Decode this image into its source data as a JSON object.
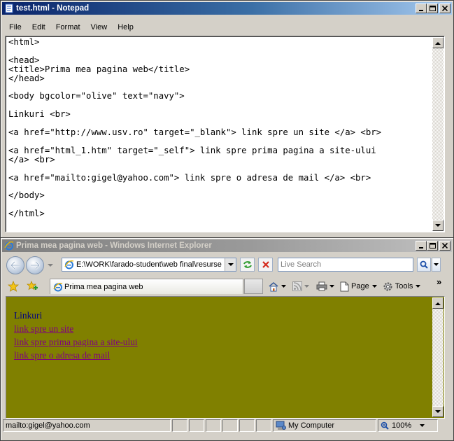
{
  "notepad": {
    "title": "test.html - Notepad",
    "menu": [
      "File",
      "Edit",
      "Format",
      "View",
      "Help"
    ],
    "lines": [
      "<html>",
      "",
      "<head>",
      "<title>Prima mea pagina web</title>",
      "</head>",
      "",
      "<body bgcolor=\"olive\" text=\"navy\">",
      "",
      "Linkuri <br>",
      "",
      "<a href=\"http://www.usv.ro\" target=\"_blank\"> link spre un site </a> <br>",
      "",
      "<a href=\"html_1.htm\" target=\"_self\"> link spre prima pagina a site-ului",
      "</a> <br>",
      "",
      "<a href=\"mailto:gigel@yahoo.com\"> link spre o adresa de mail </a> <br>",
      "",
      "</body>",
      "",
      "</html>"
    ]
  },
  "ie": {
    "title": "Prima mea pagina web - Windows Internet Explorer",
    "address": "E:\\WORK\\farado-student\\web final\\resurse",
    "search_placeholder": "Live Search",
    "tab_label": "Prima mea pagina web",
    "toolbar": {
      "page_label": "Page",
      "tools_label": "Tools",
      "more": "»"
    },
    "page": {
      "heading_text": "Linkuri",
      "links": [
        "link spre un site",
        "link spre prima pagina a site-ului",
        "link spre o adresa de mail"
      ],
      "bgcolor": "#808000",
      "text_color": "#000080",
      "link_color": "#800080"
    },
    "status": {
      "text": "mailto:gigel@yahoo.com",
      "zone": "My Computer",
      "zoom": "100%"
    }
  },
  "window_buttons": {
    "minimize": "_",
    "maximize": "□",
    "close": "×"
  }
}
